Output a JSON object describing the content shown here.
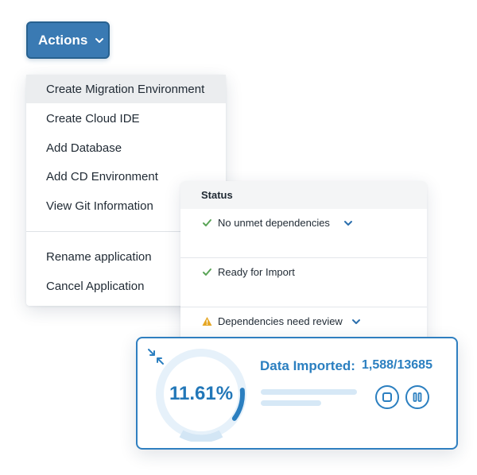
{
  "actions_button": {
    "label": "Actions",
    "icon": "chevron-down-icon"
  },
  "menu": {
    "items": [
      {
        "label": "Create Migration Environment"
      },
      {
        "label": "Create Cloud IDE"
      },
      {
        "label": "Add Database"
      },
      {
        "label": "Add CD Environment"
      },
      {
        "label": "View Git Information"
      },
      {
        "label": "Rename application"
      },
      {
        "label": "Cancel Application"
      }
    ],
    "highlighted_item": "Create Migration Environment"
  },
  "status_panel": {
    "header": "Status",
    "rows": [
      {
        "text": "No unmet dependencies",
        "status": "success",
        "icon": "check-icon",
        "expandable": true
      },
      {
        "text": "Ready for Import",
        "status": "success",
        "icon": "check-icon",
        "expandable": false
      },
      {
        "text": "Dependencies need review",
        "status": "warning",
        "icon": "warning-icon",
        "expandable": true
      }
    ]
  },
  "import_card": {
    "percent_text": "11.61%",
    "percent": 11.61,
    "label": "Data Imported:",
    "count": "1,588/13685",
    "buttons": [
      "stop-icon",
      "pause-icon"
    ]
  },
  "colors": {
    "accent": "#2b7fc0",
    "button": "#3a7ab3",
    "success": "#5aa457",
    "warning": "#e5a623",
    "ring_track": "#dcebf7"
  }
}
